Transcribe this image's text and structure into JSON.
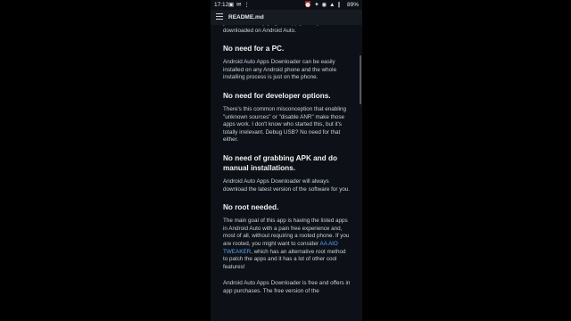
{
  "status_bar": {
    "time": "17:12",
    "left_icons": "▣ ✉ ⋮",
    "right_icons": "⏰ ✦ ◉ ▲ ∥",
    "battery": "89%"
  },
  "app_bar": {
    "title": "README.md"
  },
  "article": {
    "intro_text": "you can start enjoying the app you've just downloaded on Android Auto.",
    "sections": [
      {
        "heading": "No need for a PC.",
        "body": "Android Auto Apps Downloader can be easily installed on any Android phone and the whole installing process is just on the phone."
      },
      {
        "heading": "No need for developer options.",
        "body": "There's this common misconception that enabling \"unknown sources\" or \"disable ANR\" make those apps work. I don't know who started this, but it's totally irrelevant. Debug USB? No need for that either."
      },
      {
        "heading": "No need of grabbing APK and do manual installations.",
        "body": "Android Auto Apps Downloader will always download the latest version of the software for you."
      },
      {
        "heading": "No root needed.",
        "body_before_link": "The main goal of this app is having the listed apps in Android Auto with a pain free experience and, most of all, without requiring a rooted phone. If you are rooted, you might want to consider ",
        "link_text": "AA AIO TWEAKER",
        "body_after_link": ", which has an alternative root method to patch the apps and it has a lot of other cool features!"
      }
    ],
    "final_text": "Android Auto Apps Downloader is free and offers in app purchases. The free version of the"
  },
  "colors": {
    "background": "#0d1117",
    "app_bar": "#161b22",
    "heading": "#f0f0f0",
    "body_text": "#c9d1d9",
    "link": "#58a6ff"
  }
}
